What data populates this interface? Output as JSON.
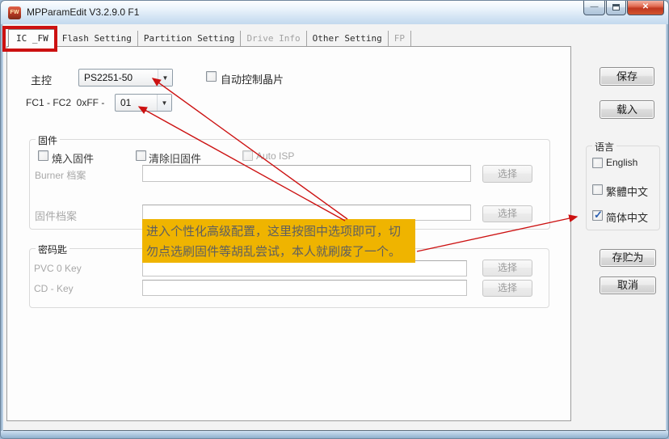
{
  "window": {
    "title": "MPParamEdit V3.2.9.0 F1",
    "icon_text": "FW"
  },
  "tabs": [
    {
      "label": "IC _FW",
      "state": "active"
    },
    {
      "label": "Flash Setting",
      "state": "enabled"
    },
    {
      "label": "Partition Setting",
      "state": "enabled"
    },
    {
      "label": "Drive Info",
      "state": "disabled"
    },
    {
      "label": "Other Setting",
      "state": "enabled"
    },
    {
      "label": "FP",
      "state": "disabled"
    }
  ],
  "form": {
    "controller": {
      "label": "主控",
      "value": "PS2251-50"
    },
    "auto_chip": {
      "label": "自动控制晶片",
      "checked": false
    },
    "fc": {
      "label": "FC1 - FC2  0xFF -",
      "value": "01"
    },
    "firmware": {
      "title": "固件",
      "burn": {
        "label": "燒入固件",
        "checked": false
      },
      "clear": {
        "label": "清除旧固件",
        "checked": false
      },
      "auto_isp": {
        "label": "Auto ISP",
        "checked": false
      },
      "burner_file": {
        "label": "Burner 档案",
        "value": ""
      },
      "fw_file": {
        "label": "固件档案",
        "value": ""
      },
      "select_label": "选择"
    },
    "keys": {
      "title": "密码匙",
      "pvc": {
        "label": "PVC 0 Key",
        "value": ""
      },
      "cd": {
        "label": "CD - Key",
        "value": ""
      }
    }
  },
  "side": {
    "save": "保存",
    "load": "载入",
    "language": {
      "title": "语言",
      "options": [
        {
          "label": "English",
          "checked": false
        },
        {
          "label": "繁體中文",
          "checked": false
        },
        {
          "label": "简体中文",
          "checked": true
        }
      ]
    },
    "save_as": "存贮为",
    "cancel": "取消"
  },
  "annotation": {
    "highlight_color": "#EFB400",
    "arrow_color": "#CC1111",
    "note_line1": "进入个性化高级配置，这里按图中选项即可，切",
    "note_line2": "勿点选刷固件等胡乱尝试，本人就刷废了一个。"
  }
}
